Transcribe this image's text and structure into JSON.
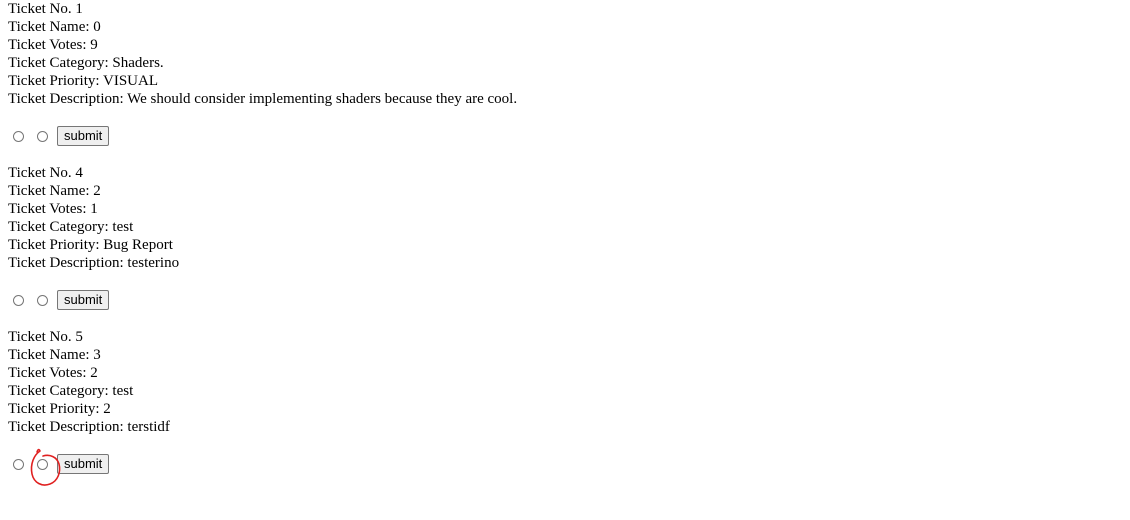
{
  "tickets": [
    {
      "no_label": "Ticket No. 1",
      "name_label": "Ticket Name: 0",
      "votes_label": "Ticket Votes: 9",
      "category_label": "Ticket Category: Shaders.",
      "priority_label": "Ticket Priority: VISUAL",
      "description_label": "Ticket Description: We should consider implementing shaders because they are cool.",
      "submit_label": "submit"
    },
    {
      "no_label": "Ticket No. 4",
      "name_label": "Ticket Name: 2",
      "votes_label": "Ticket Votes: 1",
      "category_label": "Ticket Category: test",
      "priority_label": "Ticket Priority: Bug Report",
      "description_label": "Ticket Description: testerino",
      "submit_label": "submit"
    },
    {
      "no_label": "Ticket No. 5",
      "name_label": "Ticket Name: 3",
      "votes_label": "Ticket Votes: 2",
      "category_label": "Ticket Category: test",
      "priority_label": "Ticket Priority: 2",
      "description_label": "Ticket Description: terstidf",
      "submit_label": "submit"
    }
  ],
  "annotation": {
    "color": "#e02020"
  }
}
